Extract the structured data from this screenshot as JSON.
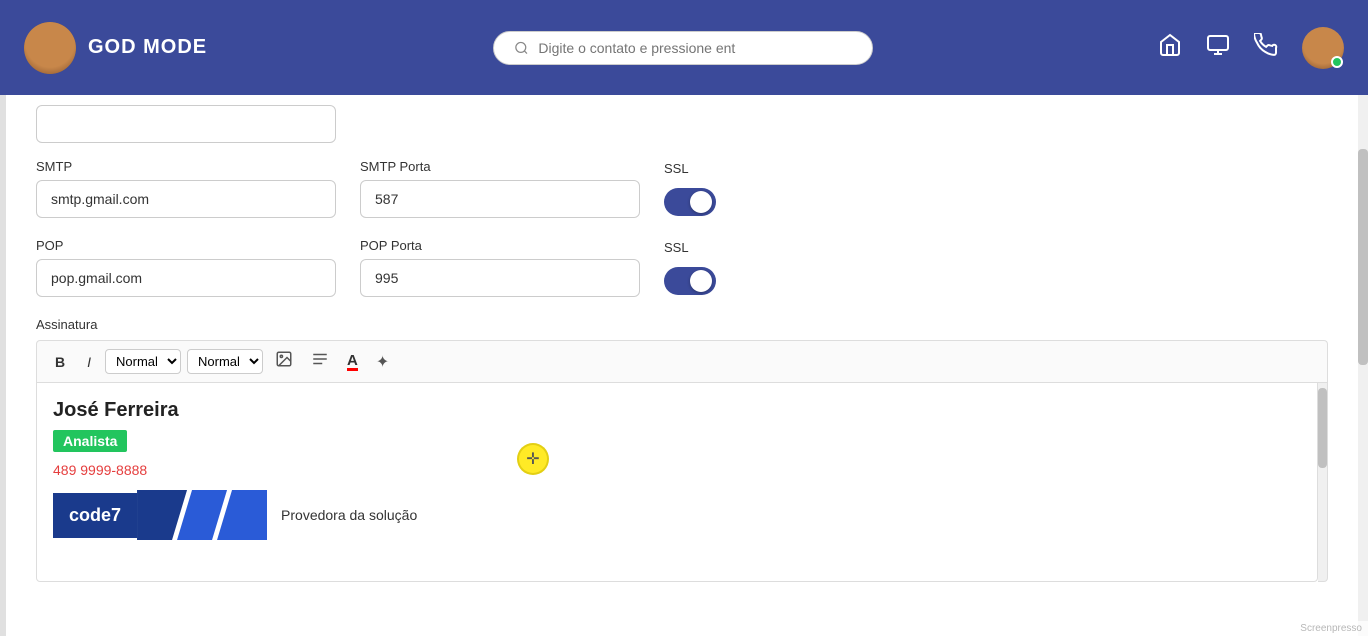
{
  "header": {
    "app_title": "GOD MODE",
    "search_placeholder": "Digite o contato e pressione ent"
  },
  "form": {
    "smtp_label": "SMTP",
    "smtp_value": "smtp.gmail.com",
    "smtp_porta_label": "SMTP Porta",
    "smtp_porta_value": "587",
    "ssl_label_1": "SSL",
    "pop_label": "POP",
    "pop_value": "pop.gmail.com",
    "pop_porta_label": "POP Porta",
    "pop_porta_value": "995",
    "ssl_label_2": "SSL",
    "assinatura_label": "Assinatura",
    "toolbar": {
      "bold": "B",
      "italic": "I",
      "normal_1": "Normal",
      "normal_2": "Normal",
      "img_icon": "🖼",
      "align_icon": "☰",
      "text_color_icon": "A",
      "magic_icon": "✦"
    },
    "signature": {
      "name": "José Ferreira",
      "role": "Analista",
      "phone": "489 9999-8888",
      "logo_text": "code7",
      "provider_text": "Provedora da solução"
    }
  }
}
